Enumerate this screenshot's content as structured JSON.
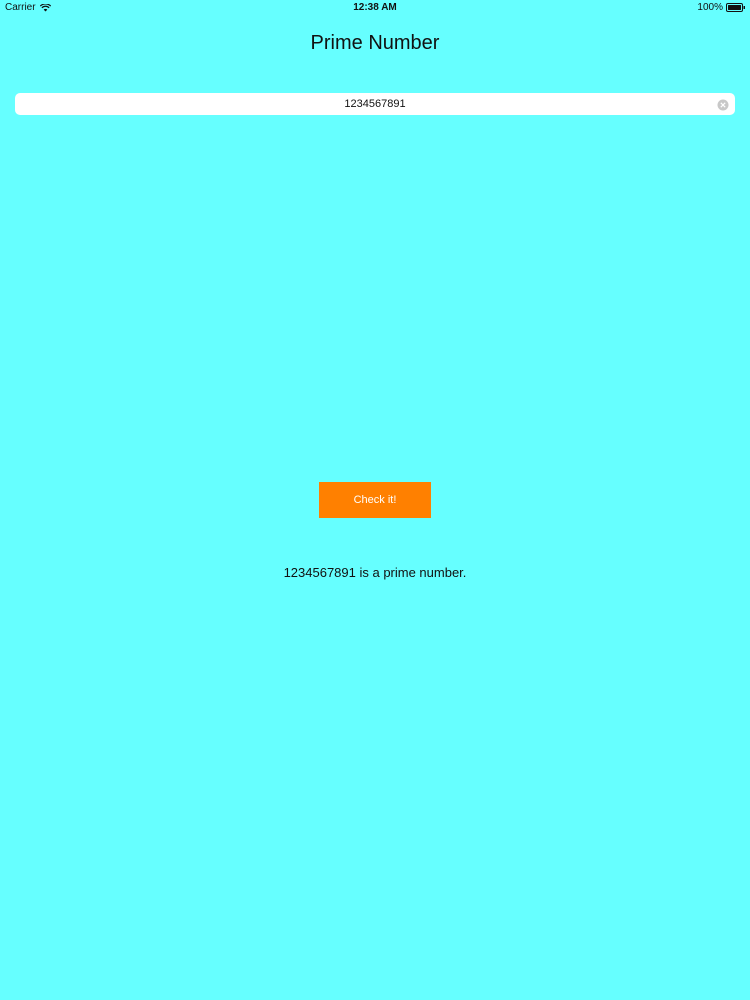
{
  "status_bar": {
    "carrier": "Carrier",
    "wifi_icon": "wifi-icon",
    "time": "12:38 AM",
    "battery_percent": "100%",
    "battery_icon": "battery-icon",
    "battery_level": 1.0
  },
  "header": {
    "title": "Prime Number"
  },
  "number_field": {
    "value": "1234567891",
    "clear_icon": "clear-icon"
  },
  "check_button": {
    "label": "Check it!",
    "color": "#ff8000"
  },
  "result": {
    "text": "1234567891 is a prime number."
  },
  "colors": {
    "background": "#66ffff",
    "button": "#ff8000",
    "field": "#ffffff"
  }
}
